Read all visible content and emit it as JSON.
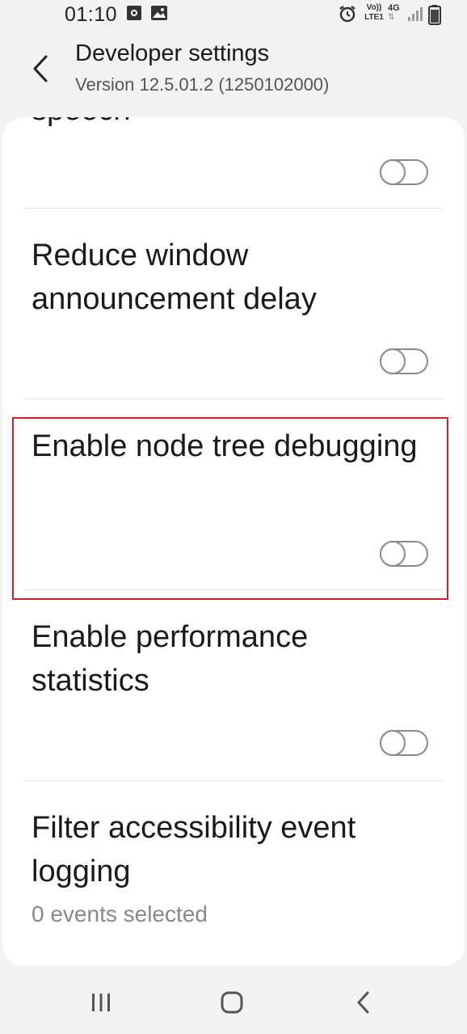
{
  "status": {
    "time": "01:10",
    "volte": "Vo))",
    "lte": "LTE1",
    "network": "4G",
    "icons": [
      "image-icon-1",
      "image-icon-2",
      "alarm-icon",
      "signal-icon",
      "battery-icon"
    ]
  },
  "header": {
    "title": "Developer settings",
    "subtitle": "Version 12.5.01.2 (1250102000)"
  },
  "items": [
    {
      "title": "Reduce window announcement delay",
      "toggle": "off"
    },
    {
      "title": "Enable node tree debugging",
      "toggle": "off"
    },
    {
      "title": "Enable performance statistics",
      "toggle": "off"
    },
    {
      "title": "Filter accessibility event logging",
      "subtitle": "0 events selected"
    }
  ],
  "partial_item": {
    "title": "speech",
    "toggle": "off"
  },
  "colors": {
    "highlight": "#d21f2b",
    "background": "#f2f2f2",
    "card": "#ffffff"
  },
  "nav": {
    "icons": [
      "recents-icon",
      "home-icon",
      "back-icon"
    ]
  }
}
